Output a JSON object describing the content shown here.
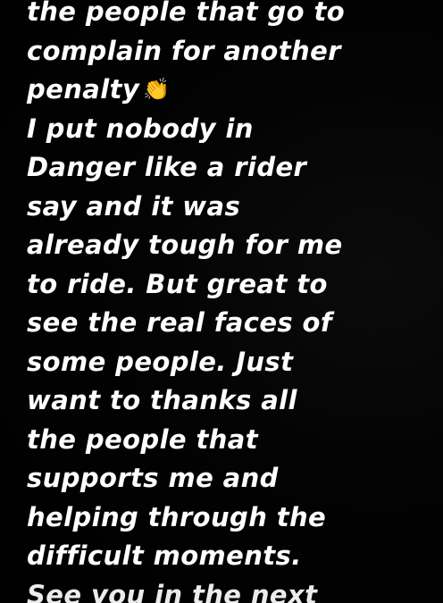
{
  "story": {
    "lines": [
      "the people that go to",
      "complain for another",
      "penalty",
      "I put nobody in",
      "Danger like a rider",
      "say and it was",
      "already tough for me",
      "to ride. But great to",
      "see the real faces of",
      "some people. Just",
      "want to thanks all",
      "the people that",
      "supports me and",
      "helping through the",
      "difficult moments.",
      "See you in the next"
    ],
    "emoji": "👏",
    "emoji_icon": "clapping-hands-icon",
    "text_color": "#ffffff",
    "background_color": "#000000"
  }
}
